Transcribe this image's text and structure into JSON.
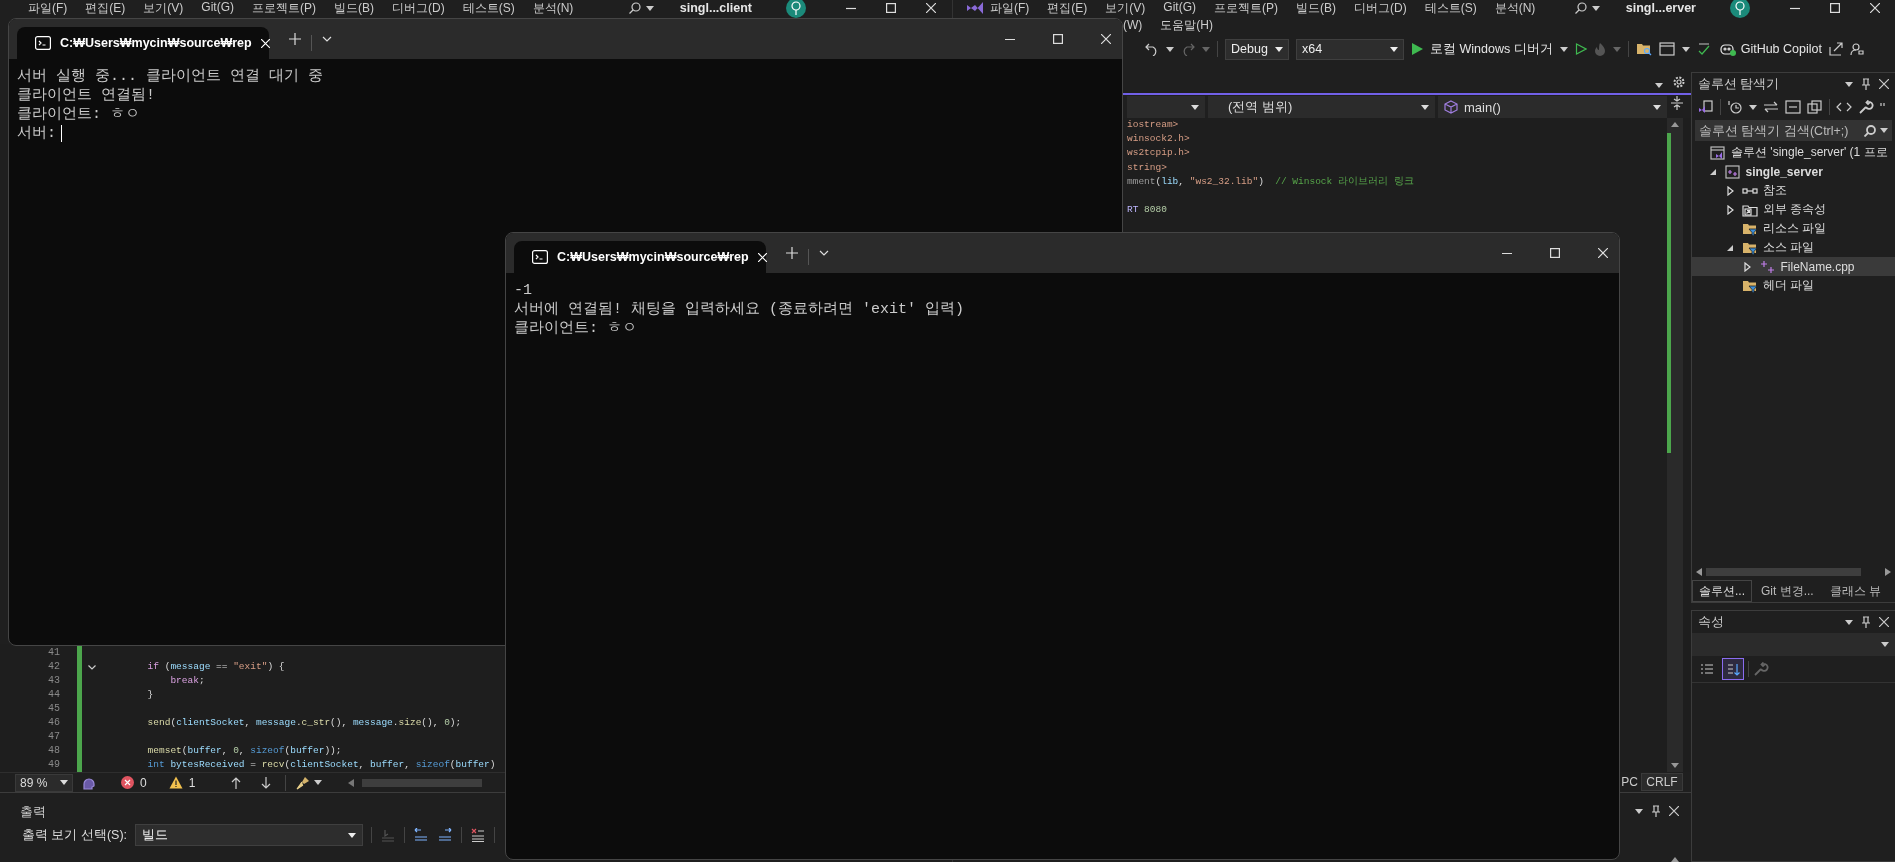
{
  "client_ide": {
    "title": "singl...client",
    "menu": [
      "파일(F)",
      "편집(E)",
      "보기(V)",
      "Git(G)",
      "프로젝트(P)",
      "빌드(B)",
      "디버그(D)",
      "테스트(S)",
      "분석(N)"
    ],
    "editor": {
      "lines": [
        {
          "number": "41",
          "kind": "blank",
          "fold": false
        },
        {
          "number": "42",
          "kind": "code",
          "fold": true,
          "tokens": [
            {
              "text": "        if",
              "kind": "ctl"
            },
            {
              "text": " (",
              "kind": "plain"
            },
            {
              "text": "message",
              "kind": "var"
            },
            {
              "text": " == ",
              "kind": "plain"
            },
            {
              "text": "\"exit\"",
              "kind": "str"
            },
            {
              "text": ") {",
              "kind": "plain"
            }
          ]
        },
        {
          "number": "43",
          "kind": "code",
          "fold": false,
          "tokens": [
            {
              "text": "            break",
              "kind": "ctl"
            },
            {
              "text": ";",
              "kind": "plain"
            }
          ]
        },
        {
          "number": "44",
          "kind": "code",
          "fold": false,
          "tokens": [
            {
              "text": "        }",
              "kind": "plain"
            }
          ]
        },
        {
          "number": "45",
          "kind": "blank",
          "fold": false
        },
        {
          "number": "46",
          "kind": "code",
          "fold": false,
          "tokens": [
            {
              "text": "        send",
              "kind": "fn"
            },
            {
              "text": "(",
              "kind": "plain"
            },
            {
              "text": "clientSocket",
              "kind": "var"
            },
            {
              "text": ", ",
              "kind": "plain"
            },
            {
              "text": "message",
              "kind": "var"
            },
            {
              "text": ".",
              "kind": "plain"
            },
            {
              "text": "c_str",
              "kind": "fn"
            },
            {
              "text": "(), ",
              "kind": "plain"
            },
            {
              "text": "message",
              "kind": "var"
            },
            {
              "text": ".",
              "kind": "plain"
            },
            {
              "text": "size",
              "kind": "fn"
            },
            {
              "text": "(), ",
              "kind": "plain"
            },
            {
              "text": "0",
              "kind": "num"
            },
            {
              "text": ");",
              "kind": "plain"
            }
          ]
        },
        {
          "number": "47",
          "kind": "blank",
          "fold": false
        },
        {
          "number": "48",
          "kind": "code",
          "fold": false,
          "tokens": [
            {
              "text": "        memset",
              "kind": "fn"
            },
            {
              "text": "(",
              "kind": "plain"
            },
            {
              "text": "buffer",
              "kind": "var"
            },
            {
              "text": ", ",
              "kind": "plain"
            },
            {
              "text": "0",
              "kind": "num"
            },
            {
              "text": ", ",
              "kind": "plain"
            },
            {
              "text": "sizeof",
              "kind": "kw"
            },
            {
              "text": "(",
              "kind": "plain"
            },
            {
              "text": "buffer",
              "kind": "var"
            },
            {
              "text": "));",
              "kind": "plain"
            }
          ]
        },
        {
          "number": "49",
          "kind": "code",
          "fold": false,
          "tokens": [
            {
              "text": "        int",
              "kind": "kw"
            },
            {
              "text": " bytesReceived",
              "kind": "var"
            },
            {
              "text": " = ",
              "kind": "plain"
            },
            {
              "text": "recv",
              "kind": "fn"
            },
            {
              "text": "(",
              "kind": "plain"
            },
            {
              "text": "clientSocket",
              "kind": "var"
            },
            {
              "text": ", ",
              "kind": "plain"
            },
            {
              "text": "buffer",
              "kind": "var"
            },
            {
              "text": ", ",
              "kind": "plain"
            },
            {
              "text": "sizeof",
              "kind": "kw"
            },
            {
              "text": "(",
              "kind": "plain"
            },
            {
              "text": "buffer",
              "kind": "var"
            },
            {
              "text": ")",
              "kind": "plain"
            }
          ]
        }
      ]
    },
    "status_bar": {
      "zoom": "89 %",
      "errors": "0",
      "warnings": "1"
    },
    "output": {
      "title": "출력",
      "source_label": "출력 보기 선택(S):",
      "source_value": "빌드"
    }
  },
  "server_ide": {
    "title": "singl...erver",
    "menu": [
      "파일(F)",
      "편집(E)",
      "보기(V)",
      "Git(G)",
      "프로젝트(P)",
      "빌드(B)",
      "디버그(D)",
      "테스트(S)",
      "분석(N)"
    ],
    "menu_row_2": [
      "(W)",
      "도움말(H)"
    ],
    "toolbar": {
      "configuration": "Debug",
      "platform": "x64",
      "debugger": "로컬 Windows 디버거",
      "copilot": "GitHub Copilot"
    },
    "editor": {
      "scope": "(전역 범위)",
      "member": "main()",
      "lines": [
        {
          "kind": "code",
          "tokens": [
            {
              "text": "iostream>",
              "kind": "str"
            }
          ]
        },
        {
          "kind": "code",
          "tokens": [
            {
              "text": "winsock2.h>",
              "kind": "str"
            }
          ]
        },
        {
          "kind": "code",
          "tokens": [
            {
              "text": "ws2tcpip.h>",
              "kind": "str"
            }
          ]
        },
        {
          "kind": "code",
          "tokens": [
            {
              "text": "string>",
              "kind": "str"
            }
          ]
        },
        {
          "kind": "code",
          "tokens": [
            {
              "text": "mment",
              "kind": "directive"
            },
            {
              "text": "(",
              "kind": "plain"
            },
            {
              "text": "lib",
              "kind": "var"
            },
            {
              "text": ", ",
              "kind": "plain"
            },
            {
              "text": "\"ws2_32.lib\"",
              "kind": "str"
            },
            {
              "text": ")  ",
              "kind": "plain"
            },
            {
              "text": "// Winsock 라이브러리 링크",
              "kind": "cmt"
            }
          ]
        },
        {
          "kind": "blank"
        },
        {
          "kind": "code",
          "tokens": [
            {
              "text": "RT",
              "kind": "macro"
            },
            {
              "text": " 8080",
              "kind": "num"
            }
          ]
        }
      ]
    },
    "status_bar": {
      "partial_item": "PC",
      "line_ending": "CRLF"
    },
    "solution_explorer": {
      "title": "솔루션 탐색기",
      "search": {
        "placeholder": "솔루션 탐색기 검색(Ctrl+;)"
      },
      "tree": [
        {
          "label": "솔루션 'single_server' (1 프로",
          "kind": "solution",
          "selected": false,
          "children": [
            {
              "label": "single_server",
              "kind": "project",
              "expanded": true,
              "selected": false,
              "children": [
                {
                  "label": "참조",
                  "kind": "references",
                  "expanded": false,
                  "selected": false
                },
                {
                  "label": "외부 종속성",
                  "kind": "dependencies",
                  "expanded": false,
                  "selected": false
                },
                {
                  "label": "리소스 파일",
                  "kind": "filter",
                  "selected": false
                },
                {
                  "label": "소스 파일",
                  "kind": "filter",
                  "expanded": true,
                  "selected": false,
                  "children": [
                    {
                      "label": "FileName.cpp",
                      "kind": "file",
                      "expanded": false,
                      "selected": true
                    }
                  ]
                },
                {
                  "label": "헤더 파일",
                  "kind": "filter",
                  "selected": false
                }
              ]
            }
          ]
        }
      ],
      "tabs": [
        {
          "label": "솔루션...",
          "selected": true
        },
        {
          "label": "Git 변경...",
          "selected": false
        },
        {
          "label": "클래스 뷰",
          "selected": false
        }
      ]
    },
    "properties": {
      "title": "속성",
      "view_buttons": [
        {
          "kind": "categorized",
          "selected": false
        },
        {
          "kind": "alphabetical",
          "selected": true
        }
      ]
    }
  },
  "consoles": [
    {
      "tab_title": "C:₩Users₩mycin₩source₩rep",
      "lines": [
        "서버 실행 중... 클라이언트 연결 대기 중",
        "클라이언트 연결됨!",
        "클라이언트: ㅎㅇ",
        "서버:"
      ],
      "cursor": true
    },
    {
      "tab_title": "C:₩Users₩mycin₩source₩rep",
      "lines": [
        "-1",
        "서버에 연결됨! 채팅을 입력하세요 (종료하려면 'exit' 입력)",
        "클라이언트: ㅎㅇ"
      ],
      "cursor": false
    }
  ]
}
